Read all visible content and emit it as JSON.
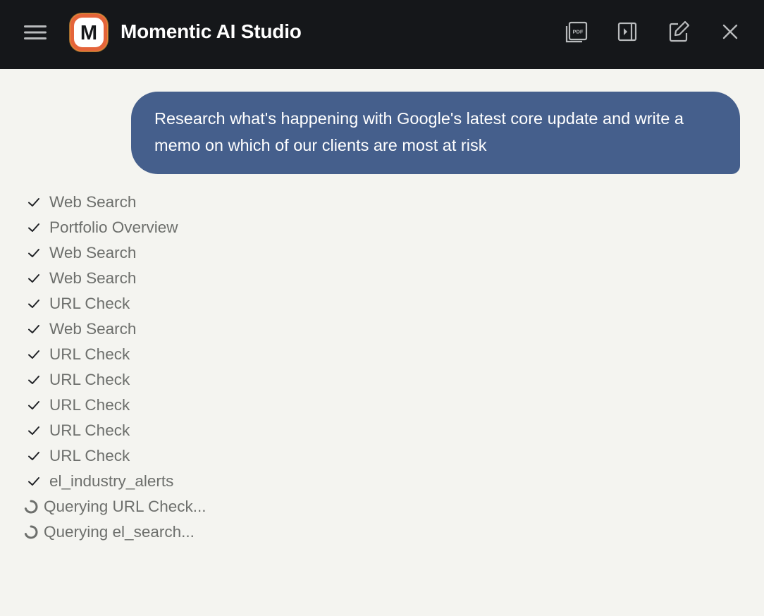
{
  "header": {
    "title": "Momentic AI Studio",
    "logo_letter": "M",
    "icons": [
      "menu-icon",
      "pdf-icon",
      "sidebar-toggle-icon",
      "edit-icon",
      "close-icon"
    ]
  },
  "chat": {
    "user_message": "Research what's happening with Google's latest core update and write a memo on which of our clients are most at risk",
    "steps": [
      {
        "label": "Web Search",
        "status": "done"
      },
      {
        "label": "Portfolio Overview",
        "status": "done"
      },
      {
        "label": "Web Search",
        "status": "done"
      },
      {
        "label": "Web Search",
        "status": "done"
      },
      {
        "label": "URL Check",
        "status": "done"
      },
      {
        "label": "Web Search",
        "status": "done"
      },
      {
        "label": "URL Check",
        "status": "done"
      },
      {
        "label": "URL Check",
        "status": "done"
      },
      {
        "label": "URL Check",
        "status": "done"
      },
      {
        "label": "URL Check",
        "status": "done"
      },
      {
        "label": "URL Check",
        "status": "done"
      },
      {
        "label": "el_industry_alerts",
        "status": "done"
      },
      {
        "label": "Querying URL Check...",
        "status": "loading"
      },
      {
        "label": "Querying el_search...",
        "status": "loading"
      }
    ]
  },
  "colors": {
    "header_bg": "#15171a",
    "page_bg": "#f4f4f0",
    "user_bubble": "#455f8c",
    "logo_ring": "#e4643a",
    "step_text": "#6d6f6c"
  }
}
